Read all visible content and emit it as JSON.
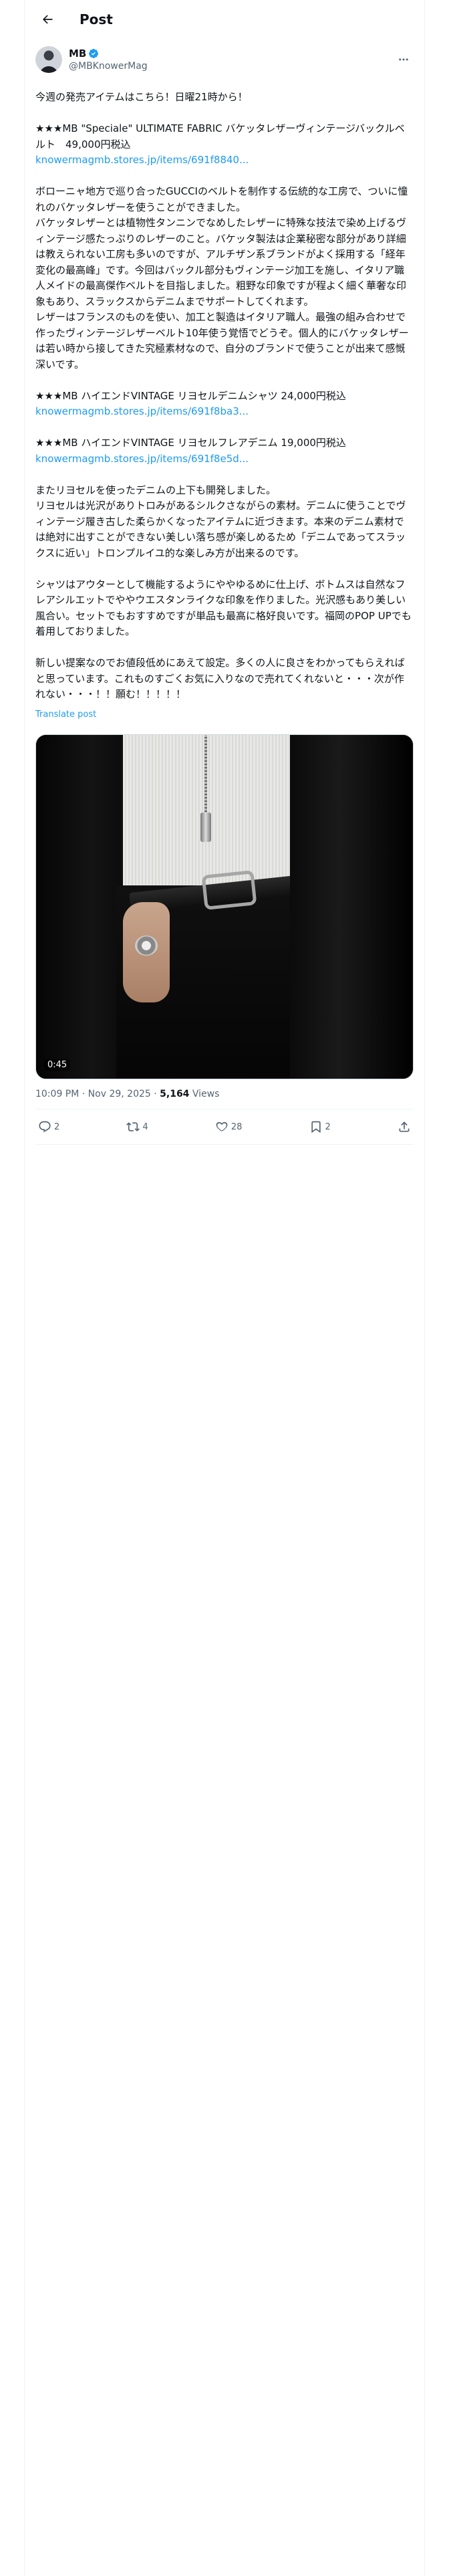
{
  "header": {
    "title": "Post"
  },
  "author": {
    "name": "MB",
    "handle": "@MBKnowerMag"
  },
  "post": {
    "paragraphs": [
      "今週の発売アイテムはこちら！日曜21時から！",
      "★★★MB \"Speciale\" ULTIMATE FABRIC バケッタレザーヴィンテージバックルベルト　49,000円税込",
      "ボローニャ地方で巡り合ったGUCCIのベルトを制作する伝統的な工房で、ついに憧れのバケッタレザーを使うことができました。\nバケッタレザーとは植物性タンニンでなめしたレザーに特殊な技法で染め上げるヴィンテージ感たっぷりのレザーのこと。バケッタ製法は企業秘密な部分があり詳細は教えられない工房も多いのですが、アルチザン系ブランドがよく採用する「経年変化の最高峰」です。今回はバックル部分もヴィンテージ加工を施し、イタリア職人メイドの最高傑作ベルトを目指しました。粗野な印象ですが程よく細く華奢な印象もあり、スラックスからデニムまでサポートしてくれます。\nレザーはフランスのものを使い、加工と製造はイタリア職人。最強の組み合わせで作ったヴィンテージレザーベルト10年使う覚悟でどうぞ。個人的にバケッタレザーは若い時から接してきた究極素材なので、自分のブランドで使うことが出来て感慨深いです。",
      "★★★MB ハイエンドVINTAGE リヨセルデニムシャツ 24,000円税込",
      "★★★MB ハイエンドVINTAGE リヨセルフレアデニム 19,000円税込",
      "またリヨセルを使ったデニムの上下も開発しました。\nリヨセルは光沢がありトロみがあるシルクさながらの素材。デニムに使うことでヴィンテージ履き古した柔らかくなったアイテムに近づきます。本来のデニム素材では絶対に出すことができない美しい落ち感が楽しめるため「デニムであってスラックスに近い」トロンプルイユ的な楽しみ方が出来るのです。",
      "シャツはアウターとして機能するようにややゆるめに仕上げ、ボトムスは自然なフレアシルエットでややウエスタンライクな印象を作りました。光沢感もあり美しい風合い。セットでもおすすめですが単品も最高に格好良いです。福岡のPOP UPでも着用しておりました。",
      "新しい提案なのでお値段低めにあえて設定。多くの人に良さをわかってもらえればと思っています。これものすごくお気に入りなので売れてくれないと・・・次が作れない・・・！！願む！！！！！"
    ],
    "links": [
      "knowermagmb.stores.jp/items/691f8840...",
      "knowermagmb.stores.jp/items/691f8ba3...",
      "knowermagmb.stores.jp/items/691f8e5d..."
    ],
    "translate_label": "Translate post",
    "video_duration": "0:45",
    "timestamp": "10:09 PM · Nov 29, 2025 · ",
    "views_count": "5,164",
    "views_label": " Views"
  },
  "actions": {
    "replies": "2",
    "reposts": "4",
    "likes": "28",
    "bookmarks": "2"
  },
  "colors": {
    "accent": "#1d9bf0",
    "muted": "#536471",
    "text": "#0f1419"
  }
}
